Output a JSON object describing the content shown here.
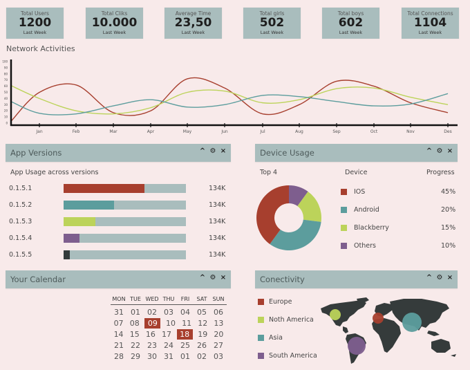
{
  "colors": {
    "background": "#f8eaea",
    "panel": "#a9bdbd",
    "red": "#a73f2e",
    "teal": "#5c9d9d",
    "green": "#bcd35a",
    "purple": "#7e5e8e",
    "dark": "#333b3b"
  },
  "stats": [
    {
      "label": "Total Users",
      "value": "1200",
      "sub": "Last Week"
    },
    {
      "label": "Total Cliks",
      "value": "10.000",
      "sub": "Last Week"
    },
    {
      "label": "Average Time",
      "value": "23,50",
      "sub": "Last Week"
    },
    {
      "label": "Total girls",
      "value": "502",
      "sub": "Last Week"
    },
    {
      "label": "Total boys",
      "value": "602",
      "sub": "Last Week"
    },
    {
      "label": "Total Connections",
      "value": "1104",
      "sub": "Last Week"
    }
  ],
  "network": {
    "title": "Network Activities"
  },
  "chart_data": {
    "type": "line",
    "title": "Network Activities",
    "xlabel": "",
    "ylabel": "",
    "x": [
      "",
      "Jan",
      "Feb",
      "Mar",
      "Apr",
      "May",
      "Jun",
      "Jul",
      "Aug",
      "Sep",
      "Oct",
      "Nov",
      "Des"
    ],
    "yticks": [
      0,
      10,
      20,
      30,
      40,
      50,
      60,
      70,
      80,
      90,
      100
    ],
    "ylim": [
      0,
      100
    ],
    "grid": false,
    "series": [
      {
        "name": "red",
        "color": "#a73f2e",
        "values": [
          3,
          50,
          62,
          17,
          20,
          72,
          57,
          15,
          30,
          68,
          60,
          33,
          17
        ]
      },
      {
        "name": "green",
        "color": "#bcd35a",
        "values": [
          61,
          40,
          20,
          15,
          25,
          50,
          52,
          33,
          38,
          56,
          57,
          42,
          30
        ]
      },
      {
        "name": "teal",
        "color": "#5c9d9d",
        "values": [
          35,
          16,
          15,
          28,
          38,
          26,
          30,
          45,
          43,
          35,
          28,
          31,
          48
        ]
      }
    ]
  },
  "app_versions": {
    "title": "App Versions",
    "subtitle": "App Usage across versions",
    "controls": {
      "collapse": "^",
      "settings": "⚙",
      "close": "×"
    },
    "rows": [
      {
        "version": "0.1.5.1",
        "progress": 0.66,
        "color": "#a73f2e",
        "value": "134K"
      },
      {
        "version": "0.1.5.2",
        "progress": 0.41,
        "color": "#5c9d9d",
        "value": "134K"
      },
      {
        "version": "0.1.5.3",
        "progress": 0.26,
        "color": "#bcd35a",
        "value": "134K"
      },
      {
        "version": "0.1.5.4",
        "progress": 0.13,
        "color": "#7e5e8e",
        "value": "134K"
      },
      {
        "version": "0.1.5.5",
        "progress": 0.05,
        "color": "#333b3b",
        "value": "134K"
      }
    ]
  },
  "device_usage": {
    "title": "Device Usage",
    "top_label": "Top 4",
    "col_device": "Device",
    "col_progress": "Progress",
    "controls": {
      "collapse": "^",
      "settings": "⚙",
      "close": "×"
    },
    "items": [
      {
        "name": "IOS",
        "percent": "45%",
        "value": 45,
        "color": "#a73f2e"
      },
      {
        "name": "Android",
        "percent": "20%",
        "value": 20,
        "color": "#5c9d9d"
      },
      {
        "name": "Blackberry",
        "percent": "15%",
        "value": 15,
        "color": "#bcd35a"
      },
      {
        "name": "Others",
        "percent": "10%",
        "value": 10,
        "color": "#7e5e8e"
      }
    ],
    "donut_slices": [
      {
        "name": "Others",
        "value": 10,
        "color": "#7e5e8e"
      },
      {
        "name": "Blackberry",
        "value": 17,
        "color": "#bcd35a"
      },
      {
        "name": "Android",
        "value": 33,
        "color": "#5c9d9d"
      },
      {
        "name": "IOS",
        "value": 40,
        "color": "#a73f2e"
      }
    ]
  },
  "calendar": {
    "title": "Your Calendar",
    "controls": {
      "collapse": "^",
      "settings": "⚙",
      "close": "×"
    },
    "weekdays": [
      "MON",
      "TUE",
      "WED",
      "THU",
      "FRI",
      "SAT",
      "SUN"
    ],
    "weeks": [
      [
        "31",
        "01",
        "02",
        "03",
        "04",
        "05",
        "06"
      ],
      [
        "07",
        "08",
        "09",
        "10",
        "11",
        "12",
        "13"
      ],
      [
        "14",
        "15",
        "16",
        "17",
        "18",
        "19",
        "20"
      ],
      [
        "21",
        "22",
        "23",
        "24",
        "25",
        "26",
        "27"
      ],
      [
        "28",
        "29",
        "30",
        "31",
        "01",
        "02",
        "03"
      ]
    ],
    "highlighted": [
      "09",
      "18"
    ]
  },
  "connectivity": {
    "title": "Conectivity",
    "controls": {
      "collapse": "^",
      "settings": "⚙",
      "close": "×"
    },
    "regions": [
      {
        "name": "Europe",
        "color": "#a73f2e"
      },
      {
        "name": "Noth America",
        "color": "#bcd35a"
      },
      {
        "name": "Asia",
        "color": "#5c9d9d"
      },
      {
        "name": "South America",
        "color": "#7e5e8e"
      }
    ]
  }
}
